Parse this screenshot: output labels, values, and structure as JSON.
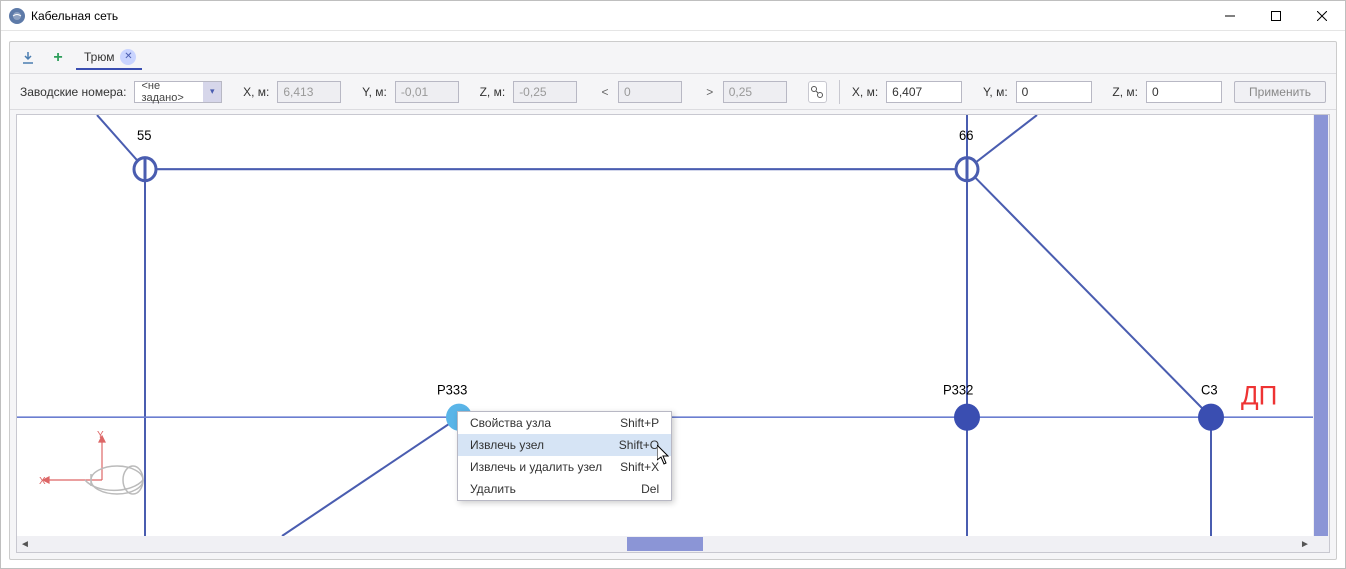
{
  "window": {
    "title": "Кабельная сеть"
  },
  "tabs": {
    "active_label": "Трюм"
  },
  "toolbar": {
    "serial_label": "Заводские номера:",
    "serial_value": "<не задано>",
    "x_label_ro": "X, м:",
    "x_value_ro": "6,413",
    "y_label_ro": "Y, м:",
    "y_value_ro": "-0,01",
    "z_label_ro": "Z, м:",
    "z_value_ro": "-0,25",
    "nav_prev_value": "0",
    "nav_next_value": "0,25",
    "x_label": "X, м:",
    "x_value": "6,407",
    "y_label": "Y, м:",
    "y_value": "0",
    "z_label": "Z, м:",
    "z_value": "0",
    "apply_label": "Применить"
  },
  "nodes": {
    "n55": "55",
    "n66": "66",
    "p333": "Р333",
    "p332": "Р332",
    "c3": "С3",
    "dp": "ДП"
  },
  "context_menu": {
    "items": [
      {
        "label": "Свойства узла",
        "shortcut": "Shift+P"
      },
      {
        "label": "Извлечь узел",
        "shortcut": "Shift+O"
      },
      {
        "label": "Извлечь и удалить узел",
        "shortcut": "Shift+X"
      },
      {
        "label": "Удалить",
        "shortcut": "Del"
      }
    ],
    "hover_index": 1
  }
}
